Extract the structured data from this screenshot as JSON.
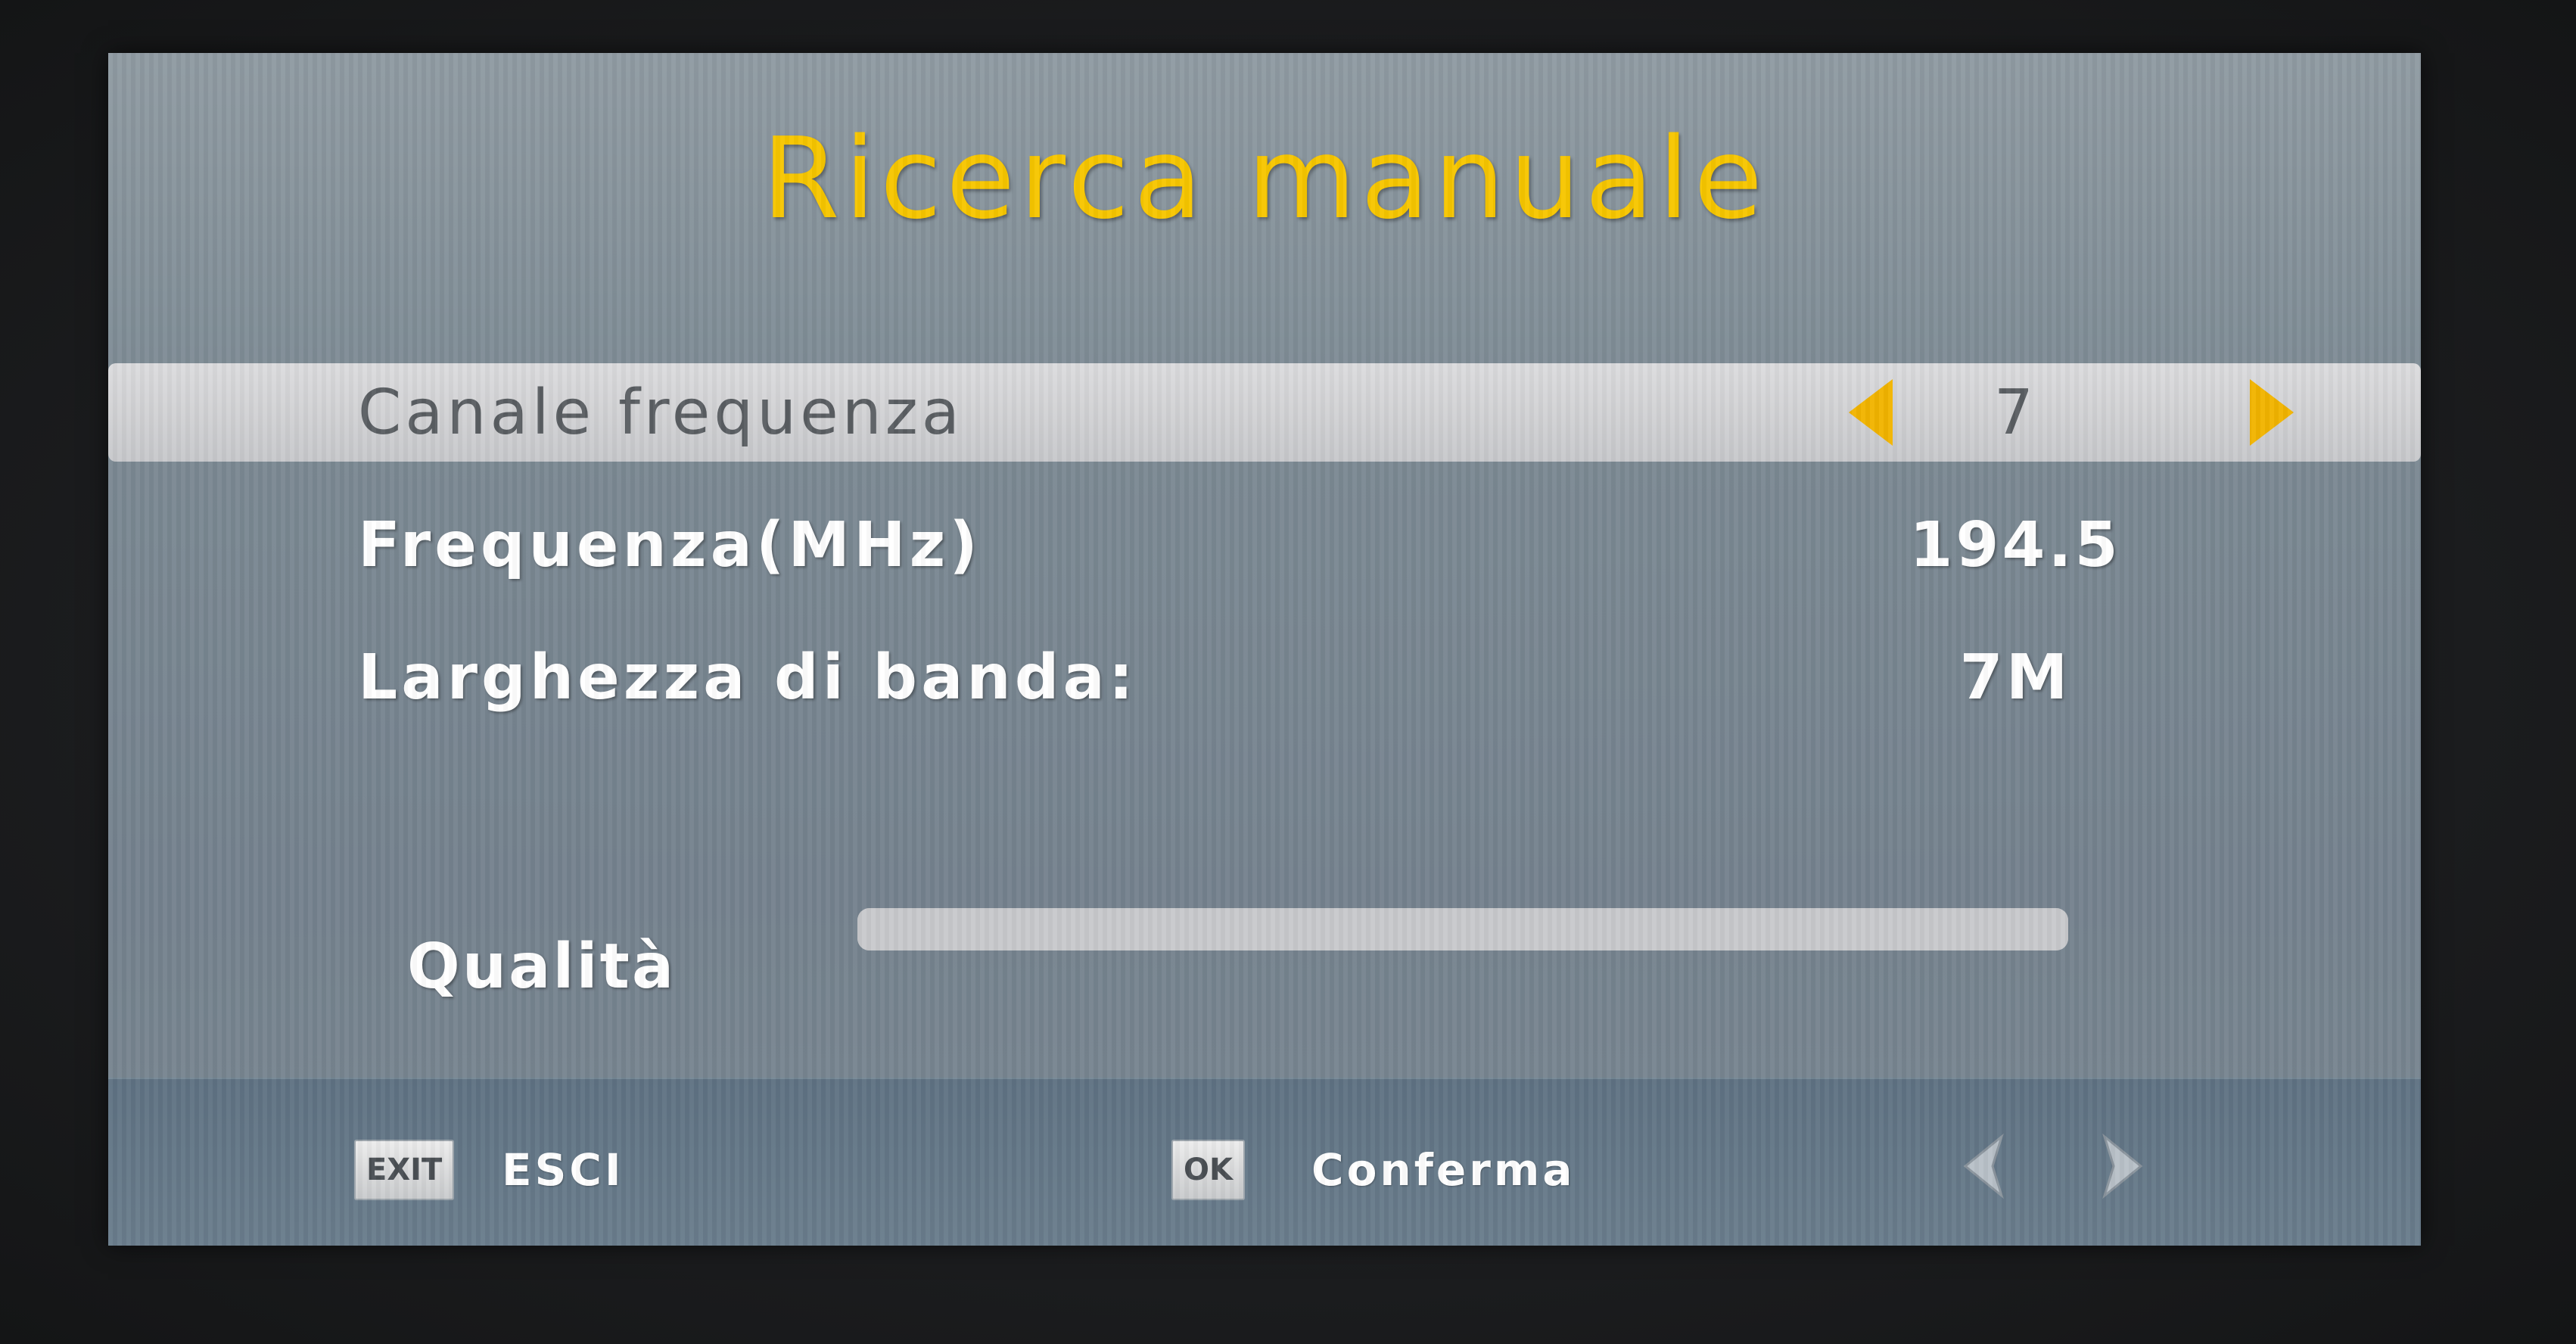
{
  "screen": {
    "title": "Ricerca manuale"
  },
  "settings": [
    {
      "label": "Canale frequenza",
      "value": "7",
      "selected": true
    },
    {
      "label": "Frequenza(MHz)",
      "value": "194.5",
      "selected": false
    },
    {
      "label": "Larghezza di banda:",
      "value": "7M",
      "selected": false
    }
  ],
  "quality": {
    "label": "Qualità",
    "level_fraction": 1.0
  },
  "footer": {
    "exit_key": "EXIT",
    "exit_label": "ESCI",
    "ok_key": "OK",
    "ok_label": "Conferma"
  },
  "icons": {
    "arrow_left": "chevron-left-icon",
    "arrow_right": "chevron-right-icon",
    "nav_left": "nav-left-icon",
    "nav_right": "nav-right-icon"
  },
  "colors": {
    "title": "#f7c600",
    "arrow": "#f2b400",
    "panel": "#808e98",
    "footer": "#5f7283",
    "selected_row": "#d0d1d4"
  }
}
